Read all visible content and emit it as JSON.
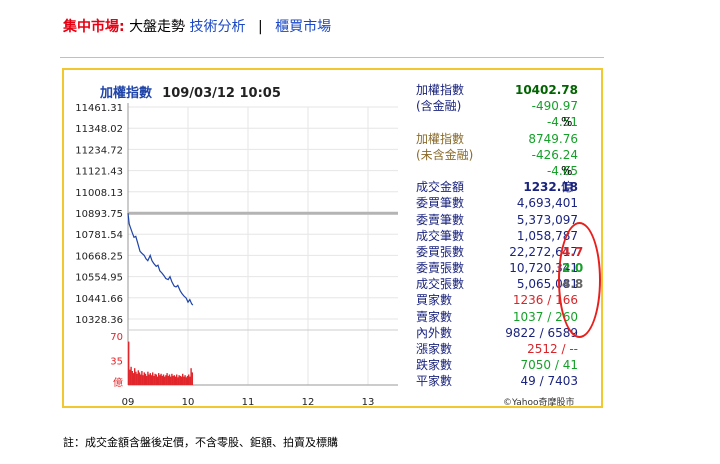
{
  "nav": {
    "market": "集中市場:",
    "current": "大盤走勢",
    "technical": "技術分析",
    "separator": "|",
    "counter": "櫃買市場"
  },
  "chart_title": {
    "name": "加權指數",
    "timestamp": "109/03/12 10:05"
  },
  "stats": {
    "rows": [
      {
        "label": "加權指數",
        "value": "10402.78",
        "suffix": ""
      },
      {
        "label": "(含金融)",
        "value": "-490.97",
        "suffix": ""
      },
      {
        "label": "",
        "value": "-4.51",
        "suffix": "%"
      },
      {
        "label": "加權指數",
        "value": "8749.76",
        "suffix": ""
      },
      {
        "label": "(未含金融)",
        "value": "-426.24",
        "suffix": ""
      },
      {
        "label": "",
        "value": "-4.65",
        "suffix": "%"
      },
      {
        "label": "成交金額",
        "value": "1232.18",
        "suffix": "億"
      },
      {
        "label": "委買筆數",
        "value": "4,693,401",
        "suffix": ""
      },
      {
        "label": "委賣筆數",
        "value": "5,373,097",
        "suffix": ""
      },
      {
        "label": "成交筆數",
        "value": "1,058,787",
        "suffix": ""
      },
      {
        "label": "委買張數",
        "value": "22,272,617",
        "suffix": ""
      },
      {
        "label": "委賣張數",
        "value": "10,720,341",
        "suffix": ""
      },
      {
        "label": "成交張數",
        "value": "5,065,081",
        "suffix": ""
      },
      {
        "label": "買家數",
        "value": "1236 / 166",
        "suffix": ""
      },
      {
        "label": "賣家數",
        "value": "1037 / 260",
        "suffix": ""
      },
      {
        "label": "內外數",
        "value": "9822 / 6589",
        "suffix": ""
      },
      {
        "label": "漲家數",
        "value": "2512 / --",
        "suffix": ""
      },
      {
        "label": "跌家數",
        "value": "7050 / 41",
        "suffix": ""
      },
      {
        "label": "平家數",
        "value": "49 / 7403",
        "suffix": ""
      }
    ],
    "annotations": [
      "4.7",
      "2.0",
      "4.8"
    ]
  },
  "colors": {
    "market_label": "#e60012",
    "link": "#1a48c6",
    "panel_border": "#f2c830",
    "price_line": "#1f44a8",
    "reference_line": "#b4b4b4",
    "volume_bars": "#e0262a",
    "annotation_ring": "#e8201c"
  },
  "credit": "©Yahoo奇摩股市",
  "footnote": "註：成交金額含盤後定價，不含零股、鉅額、拍賣及標購",
  "chart_data": {
    "type": "line",
    "title": "加權指數 109/03/12 10:05",
    "y_ticks": [
      "11461.31",
      "11348.02",
      "11234.72",
      "11121.43",
      "11008.13",
      "10893.75",
      "10781.54",
      "10668.25",
      "10554.95",
      "10441.66",
      "10328.36"
    ],
    "ylim": [
      10328.36,
      11461.31
    ],
    "x_ticks": [
      "09",
      "10",
      "11",
      "12",
      "13"
    ],
    "xlim": [
      9.0,
      13.5
    ],
    "reference_value": 10893.75,
    "series": [
      {
        "x": [
          9.0,
          9.02,
          9.04,
          9.07,
          9.1,
          9.13,
          9.17,
          9.2,
          9.23,
          9.27,
          9.3,
          9.33,
          9.37,
          9.4,
          9.43,
          9.47,
          9.5,
          9.53,
          9.57,
          9.6,
          9.63,
          9.67,
          9.7,
          9.73,
          9.77,
          9.8,
          9.83,
          9.87,
          9.9,
          9.93,
          9.97,
          10.0,
          10.03,
          10.06,
          10.08
        ],
        "y": [
          10893.75,
          10836.0,
          10818.0,
          10790.0,
          10765.0,
          10770.0,
          10725.0,
          10690.0,
          10680.0,
          10668.0,
          10650.0,
          10640.0,
          10668.0,
          10640.0,
          10625.0,
          10610.0,
          10616.0,
          10586.0,
          10572.0,
          10560.0,
          10545.0,
          10539.0,
          10555.0,
          10528.0,
          10504.0,
          10500.0,
          10508.0,
          10479.0,
          10464.0,
          10452.0,
          10440.0,
          10418.0,
          10432.0,
          10410.0,
          10402.78
        ]
      }
    ],
    "volume_axis": {
      "ticks": [
        "70",
        "35"
      ],
      "unit": "億",
      "ylim": [
        0,
        70
      ]
    },
    "volume": {
      "x": [
        9.0,
        9.02,
        9.04,
        9.06,
        9.08,
        9.1,
        9.12,
        9.14,
        9.16,
        9.18,
        9.2,
        9.22,
        9.24,
        9.26,
        9.28,
        9.3,
        9.32,
        9.34,
        9.36,
        9.38,
        9.4,
        9.42,
        9.44,
        9.46,
        9.48,
        9.5,
        9.52,
        9.54,
        9.56,
        9.58,
        9.6,
        9.62,
        9.64,
        9.66,
        9.68,
        9.7,
        9.72,
        9.74,
        9.76,
        9.78,
        9.8,
        9.82,
        9.84,
        9.86,
        9.88,
        9.9,
        9.92,
        9.94,
        9.96,
        9.98,
        10.0,
        10.02,
        10.04,
        10.06
      ],
      "values": [
        62,
        22,
        26,
        20,
        17,
        24,
        19,
        16,
        21,
        18,
        15,
        20,
        14,
        18,
        16,
        13,
        19,
        15,
        17,
        14,
        18,
        13,
        16,
        15,
        12,
        17,
        14,
        16,
        13,
        15,
        12,
        14,
        17,
        13,
        15,
        12,
        16,
        13,
        14,
        12,
        15,
        11,
        14,
        13,
        12,
        16,
        12,
        14,
        11,
        13,
        15,
        12,
        24,
        18
      ]
    }
  }
}
